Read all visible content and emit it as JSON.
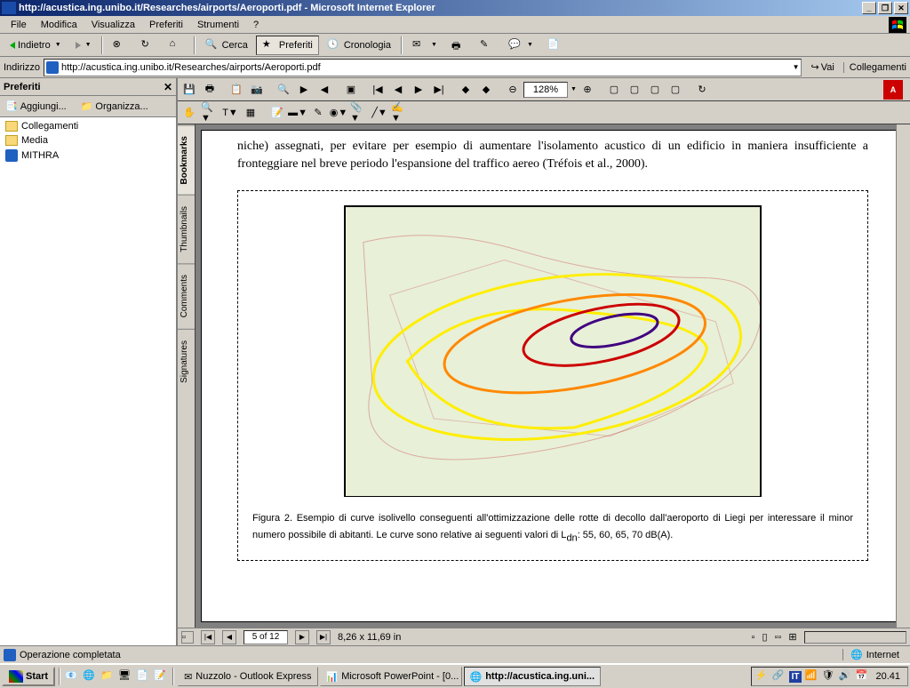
{
  "window": {
    "title": "http://acustica.ing.unibo.it/Researches/airports/Aeroporti.pdf - Microsoft Internet Explorer"
  },
  "menubar": [
    "File",
    "Modifica",
    "Visualizza",
    "Preferiti",
    "Strumenti",
    "?"
  ],
  "toolbar": {
    "back": "Indietro",
    "search": "Cerca",
    "favorites": "Preferiti",
    "history": "Cronologia"
  },
  "addressbar": {
    "label": "Indirizzo",
    "url": "http://acustica.ing.unibo.it/Researches/airports/Aeroporti.pdf",
    "go": "Vai",
    "links": "Collegamenti"
  },
  "favorites": {
    "title": "Preferiti",
    "add": "Aggiungi...",
    "organize": "Organizza...",
    "items": [
      {
        "label": "Collegamenti",
        "type": "folder"
      },
      {
        "label": "Media",
        "type": "folder"
      },
      {
        "label": "MITHRA",
        "type": "ie"
      }
    ]
  },
  "pdf": {
    "zoom": "128%",
    "tabs": [
      "Bookmarks",
      "Thumbnails",
      "Comments",
      "Signatures"
    ],
    "page_current": "5 of 12",
    "page_size": "8,26 x 11,69 in",
    "body_text": "niche) assegnati, per evitare per esempio di aumentare l'isolamento acustico di un edificio in maniera insufficiente a fronteggiare nel breve periodo l'espansione del traffico aereo (Tréfois et al., 2000).",
    "caption": "Figura 2. Esempio di curve isolivello conseguenti all'ottimizzazione delle rotte di decollo dall'aeroporto di Liegi per interessare il minor numero possibile di abitanti. Le curve sono relative ai seguenti valori di L",
    "caption_sub": "dn",
    "caption_end": ": 55, 60, 65, 70 dB(A)."
  },
  "statusbar": {
    "text": "Operazione completata",
    "zone": "Internet"
  },
  "taskbar": {
    "start": "Start",
    "tasks": [
      {
        "label": "Nuzzolo - Outlook Express",
        "active": false
      },
      {
        "label": "Microsoft PowerPoint - [0...",
        "active": false
      },
      {
        "label": "http://acustica.ing.uni...",
        "active": true
      }
    ],
    "lang": "IT",
    "clock": "20.41"
  }
}
